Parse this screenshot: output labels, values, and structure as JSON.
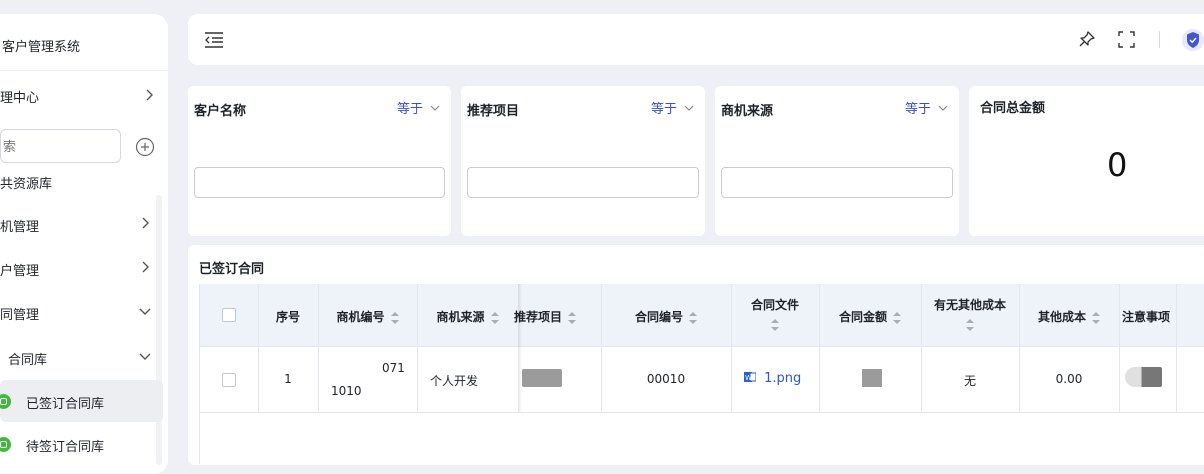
{
  "sidebar": {
    "app_title": "客户管理系统",
    "items": [
      {
        "label": "理中心"
      },
      {
        "label": "共资源库"
      },
      {
        "label": "机管理"
      },
      {
        "label": "户管理"
      },
      {
        "label": "同管理"
      },
      {
        "label": "合同库"
      },
      {
        "label": "已签订合同库"
      },
      {
        "label": "待签订合同库"
      }
    ],
    "search": {
      "placeholder": "索"
    }
  },
  "header": {
    "menu_icon": "indent-icon",
    "pin_icon": "pin-icon",
    "fullscreen_icon": "fullscreen-icon",
    "avatar_icon": "shield-icon"
  },
  "filters": [
    {
      "title": "客户名称",
      "op": "等于"
    },
    {
      "title": "推荐项目",
      "op": "等于"
    },
    {
      "title": "商机来源",
      "op": "等于"
    }
  ],
  "summary": {
    "title": "合同总金额",
    "value": "0"
  },
  "table": {
    "title": "已签订合同",
    "columns": [
      "序号",
      "商机编号",
      "商机来源",
      "推荐项目",
      "合同编号",
      "合同文件",
      "合同金额",
      "有无其他成本",
      "其他成本",
      "注意事项"
    ],
    "rows": [
      {
        "index": "1",
        "opp_no_line1": "071",
        "opp_no_line2": "1010",
        "source": "个人开发",
        "contract_no": "00010",
        "file": "1.png",
        "has_other_cost": "无",
        "other_cost": "0.00"
      }
    ]
  },
  "colors": {
    "accent": "#3a4fc9",
    "active_green": "#3fba3f"
  }
}
